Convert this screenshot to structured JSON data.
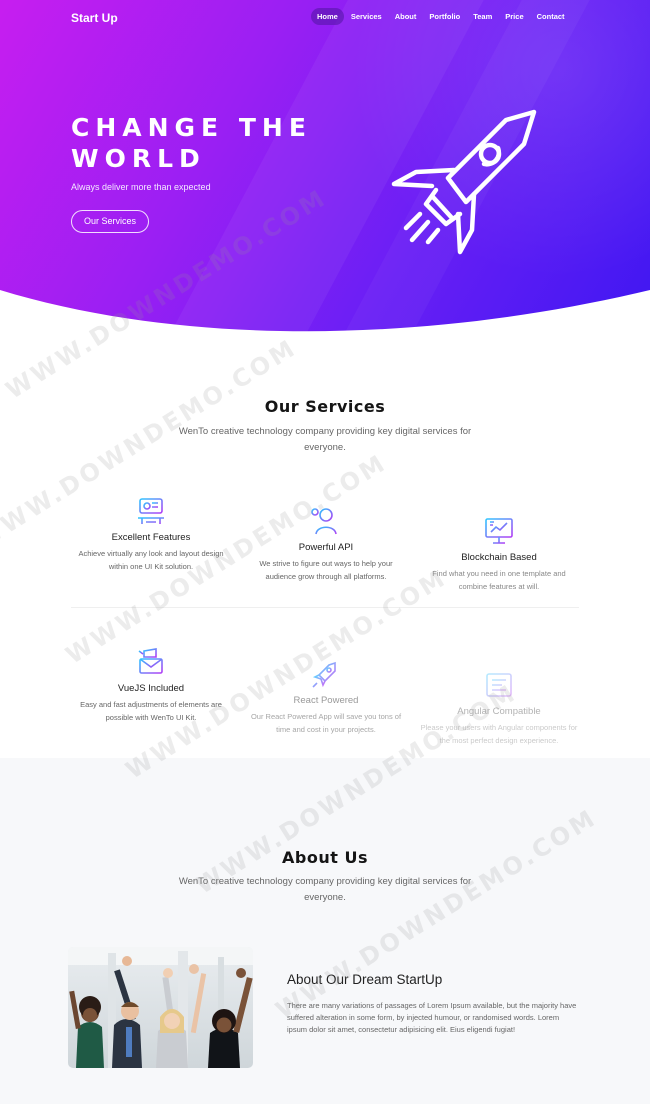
{
  "header": {
    "brand": "Start Up",
    "nav": [
      {
        "label": "Home",
        "active": true
      },
      {
        "label": "Services",
        "active": false
      },
      {
        "label": "About",
        "active": false
      },
      {
        "label": "Portfolio",
        "active": false
      },
      {
        "label": "Team",
        "active": false
      },
      {
        "label": "Price",
        "active": false
      },
      {
        "label": "Contact",
        "active": false
      }
    ]
  },
  "hero": {
    "title_line1": "CHANGE THE",
    "title_line2": "WORLD",
    "subtitle": "Always deliver more than expected",
    "cta": "Our Services",
    "illustration": "rocket-icon"
  },
  "services": {
    "title": "Our Services",
    "subtitle_line1": "WenTo creative technology company providing key digital services for",
    "subtitle_line2": "everyone.",
    "items": [
      {
        "icon": "features-icon",
        "title": "Excellent Features",
        "desc_line1": "Achieve virtually any look and layout design",
        "desc_line2": "within one UI Kit solution."
      },
      {
        "icon": "api-icon",
        "title": "Powerful API",
        "desc_line1": "We strive to figure out ways to help your",
        "desc_line2": "audience grow through all platforms."
      },
      {
        "icon": "blockchain-icon",
        "title": "Blockchain Based",
        "desc_line1": "Find what you need in one template and",
        "desc_line2": "combine features at will."
      },
      {
        "icon": "vuejs-icon",
        "title": "VueJS Included",
        "desc_line1": "Easy and fast adjustments of elements are",
        "desc_line2": "possible with WenTo UI Kit."
      },
      {
        "icon": "react-icon",
        "title": "React Powered",
        "desc_line1": "Our React Powered App will save you tons of",
        "desc_line2": "time and cost in your projects."
      },
      {
        "icon": "angular-icon",
        "title": "Angular Compatible",
        "desc_line1": "Please your users with Angular components for",
        "desc_line2": "the most perfect design experience."
      }
    ]
  },
  "about": {
    "title": "About Us",
    "subtitle_line1": "WenTo creative technology company providing key digital services for",
    "subtitle_line2": "everyone.",
    "heading": "About Our Dream StartUp",
    "paragraph": "There are many variations of passages of Lorem Ipsum available, but the majority have suffered alteration in some form, by injected humour, or randomised words. Lorem ipsum dolor sit amet, consectetur adipisicing elit. Eius eligendi fugiat!"
  },
  "watermark": "WWW.DOWNDEMO.COM",
  "colors": {
    "hero_start": "#c71ef0",
    "hero_end": "#3f17f2",
    "icon_gradient_start": "#2ec5ff",
    "icon_gradient_end": "#b23df5"
  }
}
